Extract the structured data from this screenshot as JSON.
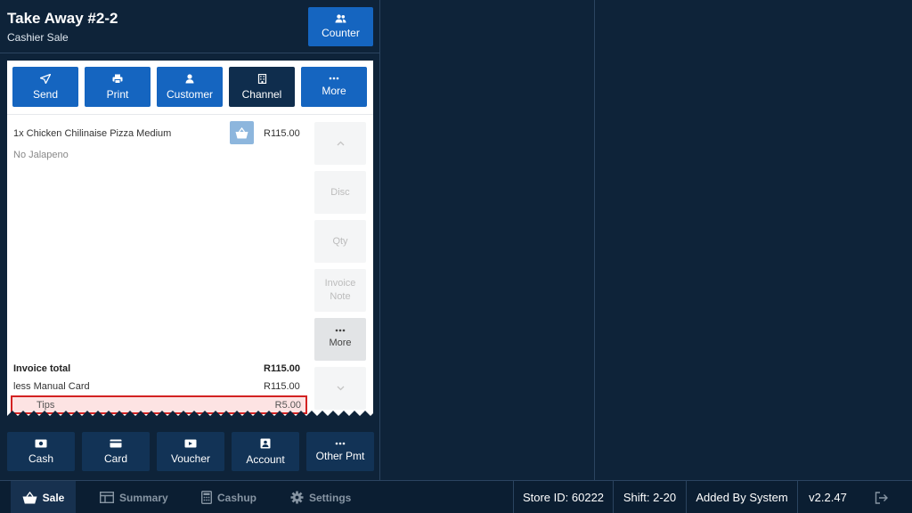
{
  "header": {
    "title": "Take Away #2-2",
    "subtitle": "Cashier Sale",
    "counter_label": "Counter"
  },
  "actions": [
    {
      "label": "Send",
      "icon": "send-icon"
    },
    {
      "label": "Print",
      "icon": "printer-icon"
    },
    {
      "label": "Customer",
      "icon": "person-icon"
    },
    {
      "label": "Channel",
      "icon": "building-icon"
    },
    {
      "label": "More",
      "icon": "dots-icon"
    }
  ],
  "order": {
    "item": "1x Chicken Chilinaise Pizza Medium",
    "modifier": "No Jalapeno",
    "price": "R115.00"
  },
  "side": {
    "disc": "Disc",
    "qty": "Qty",
    "invoice_note_1": "Invoice",
    "invoice_note_2": "Note",
    "more": "More"
  },
  "totals": {
    "invoice_label": "Invoice total",
    "invoice_value": "R115.00",
    "less_label": "less  Manual Card",
    "less_value": "R115.00",
    "tips_label": "Tips",
    "tips_value": "R5.00"
  },
  "payments": [
    {
      "label": "Cash",
      "icon": "cash-icon"
    },
    {
      "label": "Card",
      "icon": "card-icon"
    },
    {
      "label": "Voucher",
      "icon": "voucher-icon"
    },
    {
      "label": "Account",
      "icon": "account-icon"
    },
    {
      "label": "Other Pmt",
      "icon": "dots-icon"
    }
  ],
  "nav": {
    "sale": "Sale",
    "summary": "Summary",
    "cashup": "Cashup",
    "settings": "Settings"
  },
  "status": {
    "store": "Store ID: 60222",
    "shift": "Shift: 2-20",
    "added": "Added By System",
    "version": "v2.2.47"
  },
  "colors": {
    "background": "#0e2339",
    "primary": "#1565c0",
    "dark_button": "#0f2d4d",
    "highlight_border": "#d32222",
    "highlight_fill": "#fde3e3"
  }
}
